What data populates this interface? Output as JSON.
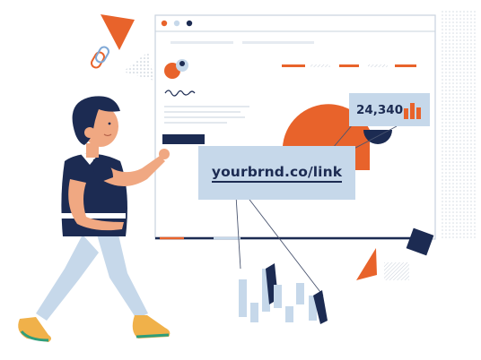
{
  "short_link": {
    "url_text": "yourbrnd.co/link",
    "url_icon": "link-card"
  },
  "click_stat": {
    "count": "24,340",
    "icon": "bar-chart-icon",
    "bars": [
      0.65,
      1.0,
      0.7
    ]
  },
  "browser": {
    "window_dots": [
      "#e8632b",
      "#c6d8ea",
      "#1c2b52"
    ]
  },
  "colors": {
    "navy": "#1c2b52",
    "orange": "#e8632b",
    "light_blue": "#c6d8ea",
    "skin": "#f0a882",
    "hair": "#1c2b52"
  }
}
